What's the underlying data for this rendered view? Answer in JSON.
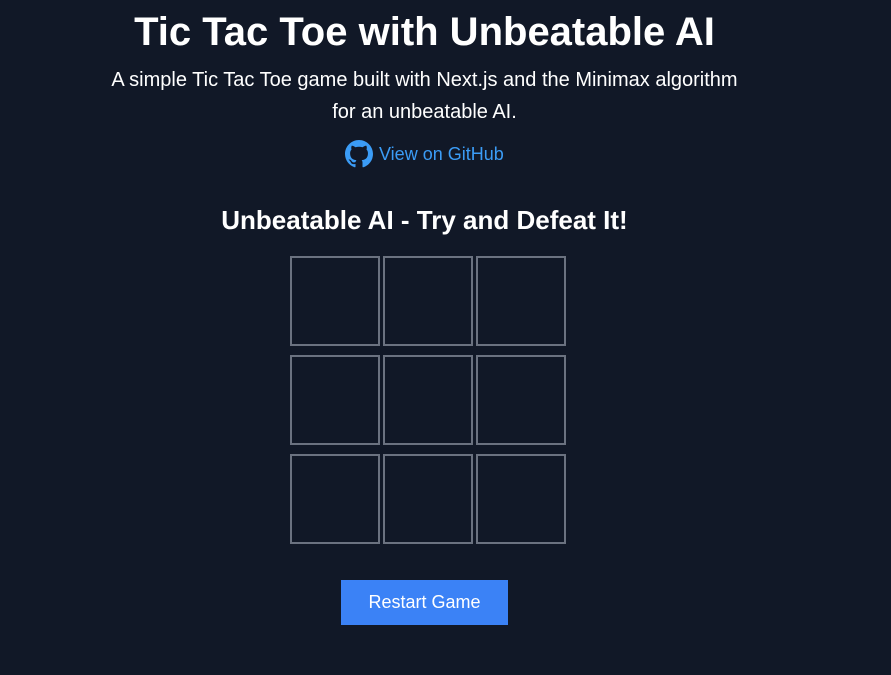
{
  "header": {
    "title": "Tic Tac Toe with Unbeatable AI",
    "description": "A simple Tic Tac Toe game built with Next.js and the Minimax algorithm for an unbeatable AI.",
    "github_link_label": "View on GitHub",
    "github_icon": "github-icon"
  },
  "game": {
    "subtitle": "Unbeatable AI - Try and Defeat It!",
    "cells": [
      "",
      "",
      "",
      "",
      "",
      "",
      "",
      "",
      ""
    ],
    "restart_label": "Restart Game"
  },
  "colors": {
    "background": "#111827",
    "text": "#ffffff",
    "link": "#3b9cf6",
    "cell_border": "#6b7280",
    "button": "#3b82f6"
  }
}
